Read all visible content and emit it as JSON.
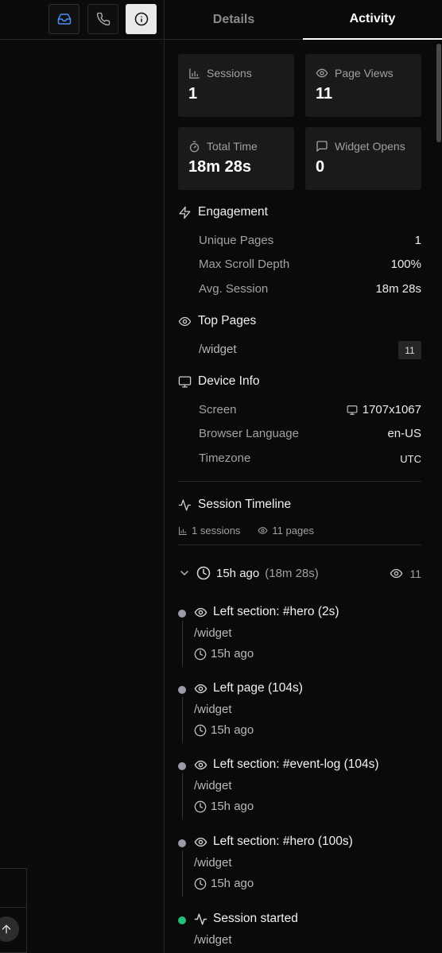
{
  "tabs": {
    "details": "Details",
    "activity": "Activity"
  },
  "stats": {
    "sessions": {
      "label": "Sessions",
      "value": "1",
      "icon": "bar-chart-icon"
    },
    "page_views": {
      "label": "Page Views",
      "value": "11",
      "icon": "eye-icon"
    },
    "total_time": {
      "label": "Total Time",
      "value": "18m 28s",
      "icon": "stopwatch-icon"
    },
    "widget_opens": {
      "label": "Widget Opens",
      "value": "0",
      "icon": "chat-icon"
    }
  },
  "engagement": {
    "title": "Engagement",
    "rows": [
      {
        "label": "Unique Pages",
        "value": "1"
      },
      {
        "label": "Max Scroll Depth",
        "value": "100%"
      },
      {
        "label": "Avg. Session",
        "value": "18m 28s"
      }
    ]
  },
  "top_pages": {
    "title": "Top Pages",
    "items": [
      {
        "path": "/widget",
        "count": "11"
      }
    ]
  },
  "device_info": {
    "title": "Device Info",
    "rows": [
      {
        "label": "Screen",
        "value": "1707x1067"
      },
      {
        "label": "Browser Language",
        "value": "en-US"
      },
      {
        "label": "Timezone",
        "value": "UTC"
      }
    ]
  },
  "timeline": {
    "title": "Session Timeline",
    "sessions_count": "1 sessions",
    "pages_count": "11 pages",
    "session": {
      "ago": "15h ago",
      "duration": "(18m 28s)",
      "views": "11"
    },
    "events": [
      {
        "title": "Left section: #hero (2s)",
        "path": "/widget",
        "time": "15h ago",
        "status": "gray"
      },
      {
        "title": "Left page (104s)",
        "path": "/widget",
        "time": "15h ago",
        "status": "gray"
      },
      {
        "title": "Left section: #event-log (104s)",
        "path": "/widget",
        "time": "15h ago",
        "status": "gray"
      },
      {
        "title": "Left section: #hero (100s)",
        "path": "/widget",
        "time": "15h ago",
        "status": "gray"
      },
      {
        "title": "Session started",
        "path": "/widget",
        "time": "",
        "status": "green"
      }
    ]
  },
  "colors": {
    "accent_blue": "#4a8df6",
    "status_green": "#22c07a",
    "status_gray": "#9a9aa8"
  }
}
